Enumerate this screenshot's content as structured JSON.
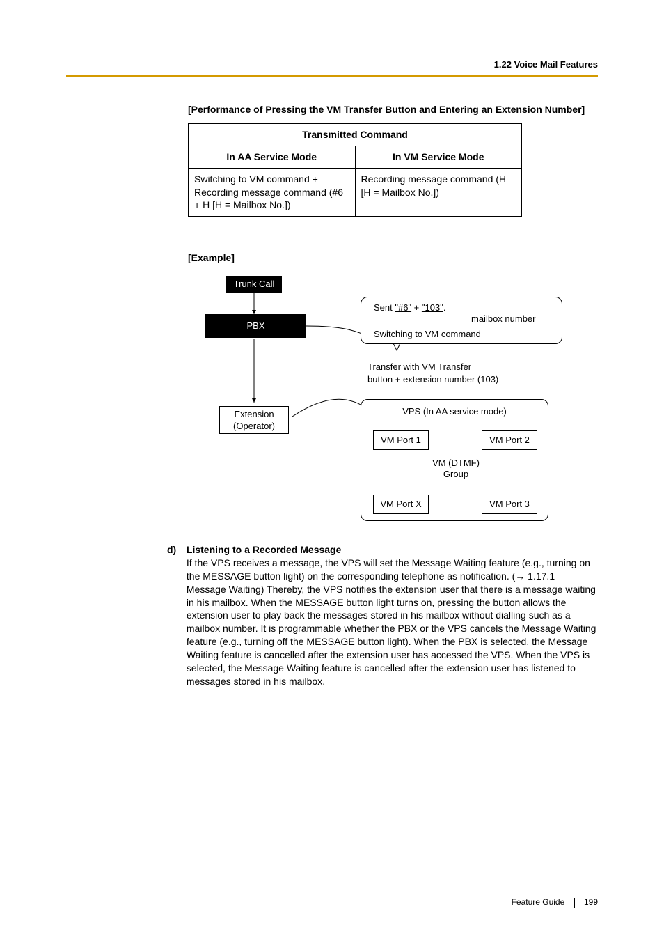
{
  "header": {
    "section_title": "1.22 Voice Mail Features"
  },
  "perf_heading": "[Performance of Pressing the VM Transfer Button and Entering an Extension Number]",
  "table": {
    "span_header": "Transmitted Command",
    "col_a": "In AA Service Mode",
    "col_b": "In VM Service Mode",
    "cell_a": "Switching to VM command + Recording message command (#6 + H [H = Mailbox No.])",
    "cell_b": "Recording message command (H [H = Mailbox No.])"
  },
  "example_title": "[Example]",
  "diagram": {
    "trunk_call": "Trunk Call",
    "pbx": "PBX",
    "extension": "Extension",
    "operator": "(Operator)",
    "sent_prefix": "Sent ",
    "sent_code": "\"#6\"",
    "sent_plus": " + ",
    "sent_mbox": "\"103\"",
    "sent_dot": ".",
    "mailbox_number": "mailbox number",
    "switch_cmd": "Switching to VM command",
    "transfer_line1": "Transfer with VM Transfer",
    "transfer_line2": "button + extension number (103)",
    "vps_title": "VPS (In AA service mode)",
    "vm_port_1": "VM Port 1",
    "vm_port_2": "VM Port 2",
    "vm_port_3": "VM Port 3",
    "vm_port_x": "VM Port X",
    "vm_dtmf": "VM (DTMF)",
    "group": "Group"
  },
  "section_d": {
    "marker": "d)",
    "title": "Listening to a Recorded Message",
    "body_1": "If the VPS receives a message, the VPS will set the Message Waiting feature (e.g., turning on the MESSAGE button light) on the corresponding telephone as notification. (",
    "ref": " 1.17.1 Message Waiting) Thereby, the VPS notifies the extension user that there is a message waiting in his mailbox. When the MESSAGE button light turns on, pressing the button allows the extension user to play back the messages stored in his mailbox without dialling such as a mailbox number. It is programmable whether the PBX or the VPS cancels the Message Waiting feature (e.g., turning off the MESSAGE button light). When the PBX is selected, the Message Waiting feature is cancelled after the extension user has accessed the VPS. When the VPS is selected, the Message Waiting feature is cancelled after the extension user has listened to messages stored in his mailbox."
  },
  "footer": {
    "guide": "Feature Guide",
    "page": "199"
  }
}
